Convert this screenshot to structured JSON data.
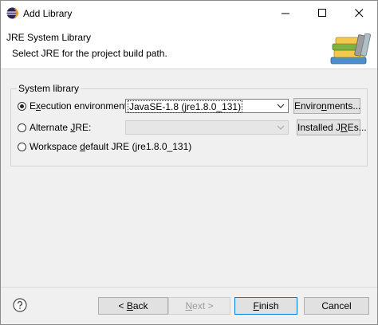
{
  "window": {
    "title": "Add Library",
    "app_icon": "eclipse-icon",
    "controls": [
      "minimize-icon",
      "maximize-icon",
      "close-icon"
    ]
  },
  "header": {
    "title": "JRE System Library",
    "description": "Select JRE for the project build path.",
    "banner_icon": "books-library-icon"
  },
  "group": {
    "legend": "System library",
    "execution_env": {
      "mnemonic": "x",
      "label_pre": "E",
      "label_post": "ecution environment:",
      "selected": true,
      "value": "JavaSE-1.8 (jre1.8.0_131)",
      "button_mnemonic": "n",
      "button_pre": "Enviro",
      "button_post": "ments..."
    },
    "alternate_jre": {
      "label_pre": "Alternate ",
      "mnemonic": "J",
      "label_post": "RE:",
      "selected": false,
      "value": "",
      "button_mnemonic": "R",
      "button_pre": "Installed J",
      "button_post": "Es..."
    },
    "workspace_default": {
      "label_pre": "Workspace ",
      "mnemonic": "d",
      "label_post": "efault JRE (jre1.8.0_131)",
      "selected": false
    }
  },
  "footer": {
    "help_icon": "help-icon",
    "back": {
      "pre": "< ",
      "mnemonic": "B",
      "post": "ack"
    },
    "next": {
      "pre": "",
      "mnemonic": "N",
      "post": "ext >"
    },
    "finish": {
      "pre": "",
      "mnemonic": "F",
      "post": "inish"
    },
    "cancel": "Cancel"
  },
  "colors": {
    "accent": "#0078d7",
    "header_bg": "#ffffff",
    "dialog_bg": "#f0f0f0"
  }
}
